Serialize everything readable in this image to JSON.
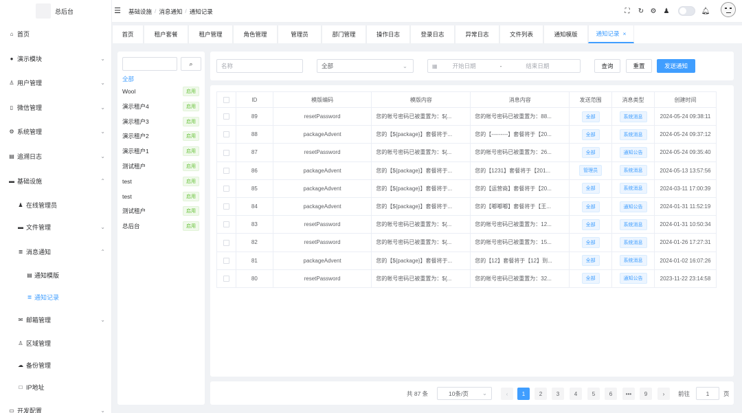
{
  "app": {
    "title": "总后台"
  },
  "breadcrumb": [
    "基础设施",
    "消息通知",
    "通知记录"
  ],
  "sidebar": {
    "items": [
      {
        "label": "首页",
        "icon": "home-icon",
        "arrow": false
      },
      {
        "label": "演示模块",
        "icon": "circle-icon",
        "arrow": true
      },
      {
        "label": "用户管理",
        "icon": "user-icon",
        "arrow": true
      },
      {
        "label": "微信管理",
        "icon": "phone-icon",
        "arrow": true
      },
      {
        "label": "系统管理",
        "icon": "gear-icon",
        "arrow": true
      },
      {
        "label": "追溯日志",
        "icon": "log-icon",
        "arrow": true
      },
      {
        "label": "基础设施",
        "icon": "folder-icon",
        "arrow": true
      },
      {
        "label": "在线管理员",
        "icon": "user-group-icon",
        "arrow": false
      },
      {
        "label": "文件管理",
        "icon": "folder-icon",
        "arrow": true
      },
      {
        "label": "消息通知",
        "icon": "database-icon",
        "arrow": true
      },
      {
        "label": "通知模版",
        "icon": "template-icon",
        "arrow": false
      },
      {
        "label": "通知记录",
        "icon": "database-icon",
        "arrow": false
      },
      {
        "label": "邮箱管理",
        "icon": "mail-icon",
        "arrow": true
      },
      {
        "label": "区域管理",
        "icon": "person-icon",
        "arrow": false
      },
      {
        "label": "备份管理",
        "icon": "cloud-icon",
        "arrow": false
      },
      {
        "label": "IP地址",
        "icon": "square-icon",
        "arrow": false
      },
      {
        "label": "开发配置",
        "icon": "monitor-icon",
        "arrow": true
      }
    ]
  },
  "tabs": [
    "首页",
    "租户套餐",
    "租户管理",
    "角色管理",
    "管理员",
    "部门管理",
    "操作日志",
    "登录日志",
    "异常日志",
    "文件列表",
    "通知模版",
    "通知记录"
  ],
  "tab_close": "×",
  "tree": {
    "root": "全部",
    "status_label": "启用",
    "items": [
      "Wool",
      "演示租户4",
      "演示租户3",
      "演示租户2",
      "演示租户1",
      "测试租户",
      "test",
      "test",
      "测试租户",
      "总后台"
    ]
  },
  "filters": {
    "name_placeholder": "名称",
    "type_value": "全部",
    "start_placeholder": "开始日期",
    "date_sep": "-",
    "end_placeholder": "结束日期",
    "query_label": "查询",
    "reset_label": "重置",
    "send_label": "发送通知"
  },
  "table": {
    "headers": [
      "ID",
      "模版编码",
      "模版内容",
      "消息内容",
      "发送范围",
      "消息类型",
      "创建时间"
    ],
    "rows": [
      {
        "id": "89",
        "code": "resetPassword",
        "tpl": "您的帐号密码已被重置为：${...",
        "msg": "您的帐号密码已被重置为：88...",
        "scope": "全部",
        "type": "系统消息",
        "time": "2024-05-24 09:38:11"
      },
      {
        "id": "88",
        "code": "packageAdvent",
        "tpl": "您的【${package}】套餐将于...",
        "msg": "您的【---------】套餐将于【20...",
        "scope": "全部",
        "type": "系统消息",
        "time": "2024-05-24 09:37:12"
      },
      {
        "id": "87",
        "code": "resetPassword",
        "tpl": "您的帐号密码已被重置为：${...",
        "msg": "您的帐号密码已被重置为：26...",
        "scope": "全部",
        "type": "通知公告",
        "time": "2024-05-24 09:35:40"
      },
      {
        "id": "86",
        "code": "packageAdvent",
        "tpl": "您的【${package}】套餐将于...",
        "msg": "您的【1231】套餐将于【201...",
        "scope": "管理员",
        "type": "系统消息",
        "time": "2024-05-13 13:57:56"
      },
      {
        "id": "85",
        "code": "packageAdvent",
        "tpl": "您的【${package}】套餐将于...",
        "msg": "您的【运营商】套餐将于【20...",
        "scope": "全部",
        "type": "系统消息",
        "time": "2024-03-11 17:00:39"
      },
      {
        "id": "84",
        "code": "packageAdvent",
        "tpl": "您的【${package}】套餐将于...",
        "msg": "您的【嘟嘟嘟】套餐将于【王...",
        "scope": "全部",
        "type": "通知公告",
        "time": "2024-01-31 11:52:19"
      },
      {
        "id": "83",
        "code": "resetPassword",
        "tpl": "您的帐号密码已被重置为：${...",
        "msg": "您的帐号密码已被重置为：12...",
        "scope": "全部",
        "type": "系统消息",
        "time": "2024-01-31 10:50:34"
      },
      {
        "id": "82",
        "code": "resetPassword",
        "tpl": "您的帐号密码已被重置为：${...",
        "msg": "您的帐号密码已被重置为：15...",
        "scope": "全部",
        "type": "系统消息",
        "time": "2024-01-26 17:27:31"
      },
      {
        "id": "81",
        "code": "packageAdvent",
        "tpl": "您的【${package}】套餐将于...",
        "msg": "您的【12】套餐将于【12】到...",
        "scope": "全部",
        "type": "系统消息",
        "time": "2024-01-02 16:07:26"
      },
      {
        "id": "80",
        "code": "resetPassword",
        "tpl": "您的帐号密码已被重置为：${...",
        "msg": "您的帐号密码已被重置为：32...",
        "scope": "全部",
        "type": "通知公告",
        "time": "2023-11-22 23:14:58"
      }
    ]
  },
  "pagination": {
    "total": "共 87 条",
    "page_size": "10条/页",
    "prev": "‹",
    "pages": [
      "1",
      "2",
      "3",
      "4",
      "5",
      "6",
      "•••",
      "9"
    ],
    "next": "›",
    "goto": "前往",
    "goto_value": "1",
    "goto_suffix": "页"
  }
}
